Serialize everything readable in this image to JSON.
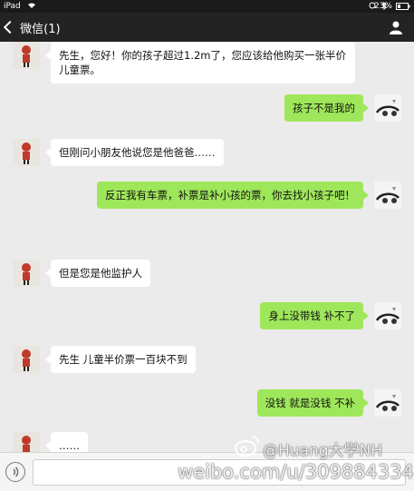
{
  "status_bar": {
    "device": "iPad",
    "battery": "23%"
  },
  "nav": {
    "back_label": "微信(1)"
  },
  "messages": [
    {
      "side": "left",
      "text": "先生，您好！你的孩子超过1.2m了，您应该给他购买一张半价儿童票。"
    },
    {
      "side": "right",
      "text": "孩子不是我的"
    },
    {
      "side": "left",
      "text": "但刚问小朋友他说您是他爸爸……"
    },
    {
      "side": "right",
      "text": "反正我有车票，补票是补小孩的票，你去找小孩子吧！"
    },
    {
      "side": "left",
      "text": "但是您是他监护人"
    },
    {
      "side": "right",
      "text": "身上没带钱 补不了"
    },
    {
      "side": "left",
      "text": "先生 儿童半价票一百块不到"
    },
    {
      "side": "right",
      "text": "没钱 就是没钱 不补"
    },
    {
      "side": "left",
      "text": "……"
    }
  ],
  "watermark": {
    "handle": "@Huang大学NH",
    "url": "weibo.com/u/3098843347"
  },
  "colors": {
    "sent_bubble": "#9fe75a",
    "received_bubble": "#ffffff",
    "chat_bg": "#ebebeb",
    "nav_bg": "#232323"
  }
}
